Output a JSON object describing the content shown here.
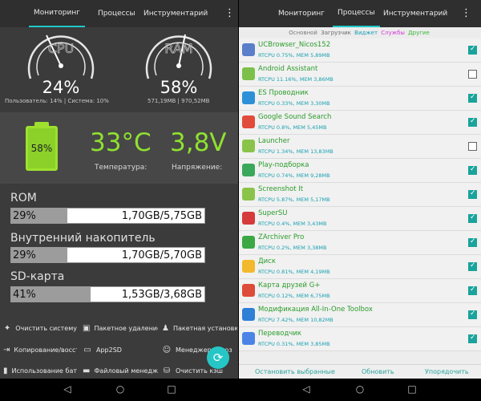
{
  "left": {
    "tabs": [
      {
        "label": "Мониторинг",
        "active": true
      },
      {
        "label": "Процессы"
      },
      {
        "label": "Инструментарий"
      }
    ],
    "menu_icon": "⋮",
    "cpu": {
      "label": "CPU",
      "percent": "24%",
      "detail": "Пользователь: 14% | Система: 10%",
      "value": 24
    },
    "ram": {
      "label": "RAM",
      "percent": "58%",
      "detail": "571,19MB | 970,52MB",
      "value": 58
    },
    "battery": {
      "percent": "58%",
      "level": 58
    },
    "temperature": {
      "value": "33°C",
      "label": "Температура:"
    },
    "voltage": {
      "value": "3,8V",
      "label": "Напряжение:"
    },
    "storage": [
      {
        "title": "ROM",
        "percent": "29%",
        "size": "1,70GB/5,75GB",
        "fill": 29
      },
      {
        "title": "Внутренний накопитель",
        "percent": "29%",
        "size": "1,70GB/5,70GB",
        "fill": 29
      },
      {
        "title": "SD-карта",
        "percent": "41%",
        "size": "1,53GB/3,68GB",
        "fill": 41
      }
    ],
    "tools": [
      {
        "label": "Очистить систему",
        "icon": "cleaner-icon"
      },
      {
        "label": "Пакетное удаление",
        "icon": "trash-icon"
      },
      {
        "label": "Пакетная установка",
        "icon": "android-icon"
      },
      {
        "label": "Копирование/восст",
        "icon": "restore-icon"
      },
      {
        "label": "App2SD",
        "icon": "sd-icon"
      },
      {
        "label": "Менеджер автоз",
        "icon": "smile-icon"
      },
      {
        "label": "Использование бат",
        "icon": "battery-icon"
      },
      {
        "label": "Файловый менедж",
        "icon": "folder-icon"
      },
      {
        "label": "Очистить кэш",
        "icon": "cache-icon"
      }
    ]
  },
  "right": {
    "tabs": [
      {
        "label": "Мониторинг"
      },
      {
        "label": "Процессы",
        "active": true
      },
      {
        "label": "Инструментарий"
      }
    ],
    "filters": [
      {
        "label": "Основной",
        "color": "#7a7a7a"
      },
      {
        "label": "Загрузчик",
        "color": "#6a6a6a"
      },
      {
        "label": "Виджет",
        "color": "#18a0b4"
      },
      {
        "label": "Службы",
        "color": "#d63ad6"
      },
      {
        "label": "Другие",
        "color": "#38b838"
      }
    ],
    "processes": [
      {
        "name": "UCBrowser_Nicos152",
        "stat": "RTCPU 0.75%, MEM 5,89MB",
        "checked": true,
        "icon": "#5a7ec9"
      },
      {
        "name": "Android Assistant",
        "stat": "RTCPU 11.16%, MEM 3,86MB",
        "checked": false,
        "icon": "#7cc04a"
      },
      {
        "name": "ES Проводник",
        "stat": "RTCPU 0.33%, MEM 3,30MB",
        "checked": true,
        "icon": "#2d8fd8"
      },
      {
        "name": "Google Sound Search",
        "stat": "RTCPU 0.8%, MEM 5,45MB",
        "checked": true,
        "icon": "#e04b3c"
      },
      {
        "name": "Launcher",
        "stat": "RTCPU 1.34%, MEM 13,83MB",
        "checked": false,
        "icon": "#8ac34a"
      },
      {
        "name": "Play-подборка",
        "stat": "RTCPU 0.74%, MEM 9,28MB",
        "checked": true,
        "icon": "#3aa85a"
      },
      {
        "name": "Screenshot It",
        "stat": "RTCPU 5.87%, MEM 5,17MB",
        "checked": true,
        "icon": "#8ac34a"
      },
      {
        "name": "SuperSU",
        "stat": "RTCPU 0.4%, MEM 3,43MB",
        "checked": true,
        "icon": "#d53b3b"
      },
      {
        "name": "ZArchiver Pro",
        "stat": "RTCPU 0.2%, MEM 3,38MB",
        "checked": true,
        "icon": "#3ba843"
      },
      {
        "name": "Диск",
        "stat": "RTCPU 0.81%, MEM 4,19MB",
        "checked": true,
        "icon": "#f2b92e"
      },
      {
        "name": "Карта друзей G+",
        "stat": "RTCPU 0.12%, MEM 6,75MB",
        "checked": true,
        "icon": "#dd4b39"
      },
      {
        "name": "Модификация All-In-One Toolbox",
        "stat": "RTCPU 7.42%, MEM 10,82MB",
        "checked": true,
        "icon": "#2e7fd6"
      },
      {
        "name": "Переводчик",
        "stat": "RTCPU 0.31%, MEM 3,85MB",
        "checked": true,
        "icon": "#4b84e6"
      }
    ],
    "actions": [
      "Остановить выбранные",
      "Обновить",
      "Упорядочить"
    ]
  },
  "nav": {
    "back": "◁",
    "home": "○",
    "recent": "□"
  }
}
